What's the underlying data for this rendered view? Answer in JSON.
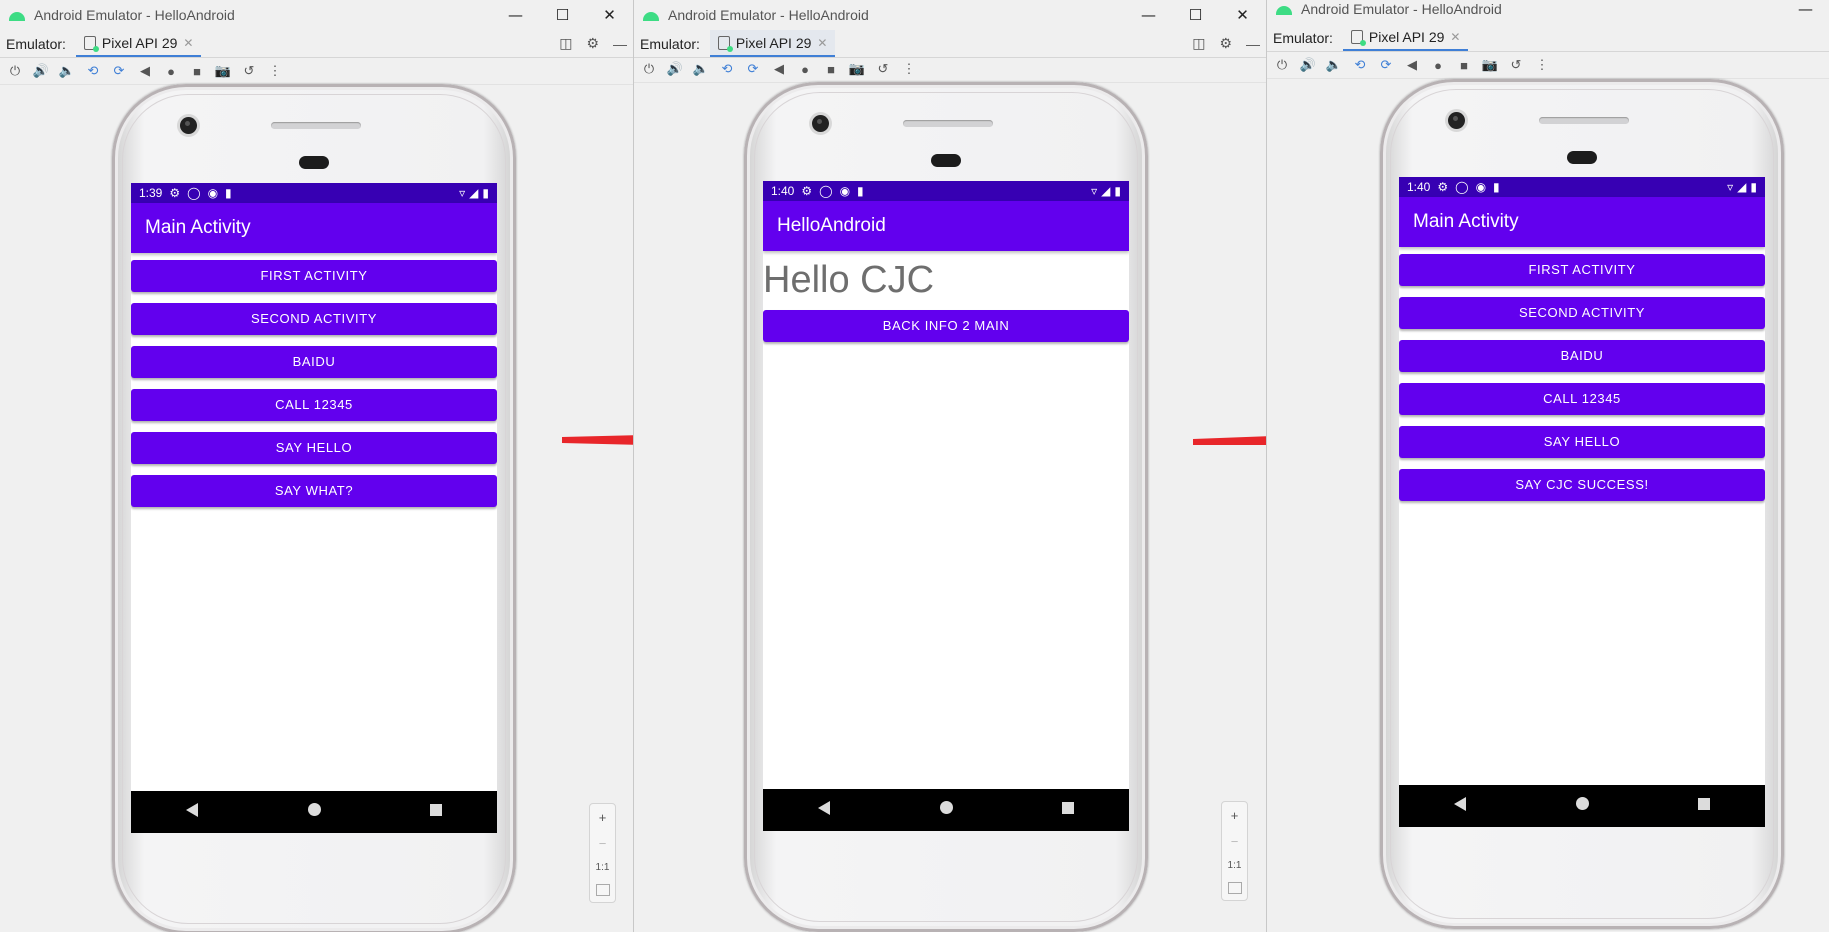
{
  "windows": [
    {
      "title": "Android Emulator - HelloAndroid",
      "emulator_label": "Emulator:",
      "tab": "Pixel API 29",
      "status_time": "1:39",
      "appbar_title": "Main Activity",
      "buttons": [
        "FIRST ACTIVITY",
        "SECOND ACTIVITY",
        "BAIDU",
        "CALL 12345",
        "SAY HELLO",
        "SAY WHAT?"
      ],
      "zoom": {
        "plus": "+",
        "minus": "−",
        "one_to_one": "1:1"
      }
    },
    {
      "title": "Android Emulator - HelloAndroid",
      "emulator_label": "Emulator:",
      "tab": "Pixel API 29",
      "status_time": "1:40",
      "appbar_title": "HelloAndroid",
      "hello_text": "Hello CJC",
      "buttons": [
        "BACK INFO 2 MAIN"
      ],
      "zoom": {
        "plus": "+",
        "minus": "−",
        "one_to_one": "1:1"
      }
    },
    {
      "title": "Android Emulator - HelloAndroid",
      "emulator_label": "Emulator:",
      "tab": "Pixel API 29",
      "status_time": "1:40",
      "appbar_title": "Main Activity",
      "buttons": [
        "FIRST ACTIVITY",
        "SECOND ACTIVITY",
        "BAIDU",
        "CALL 12345",
        "SAY HELLO",
        "SAY CJC SUCCESS!"
      ]
    }
  ],
  "colors": {
    "primary": "#6200ee",
    "status_bar": "#3700b3",
    "arrow": "#e8262a",
    "nav_bar": "#000000"
  }
}
